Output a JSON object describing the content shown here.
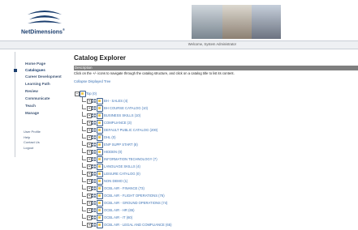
{
  "header": {
    "logo_text": "NetDimensions",
    "logo_superscript": "®",
    "welcome": "Welcome, System Administrator"
  },
  "sidebar": {
    "items": [
      {
        "label": "Home Page",
        "active": false
      },
      {
        "label": "Catalogues",
        "active": true
      },
      {
        "label": "Career Development",
        "active": false
      },
      {
        "label": "Learning Path",
        "active": false
      },
      {
        "label": "Review",
        "active": false
      },
      {
        "label": "Communicate",
        "active": false
      },
      {
        "label": "Teach",
        "active": false
      },
      {
        "label": "Manage",
        "active": false
      }
    ],
    "utility": [
      "User Profile",
      "Help",
      "Contact Us",
      "Logout"
    ]
  },
  "main": {
    "title": "Catalog Explorer",
    "description_label": "Description",
    "instructions": "Click on the +/- icons to navigate through the catalog structure, and click on a catalog title to list its content.",
    "collapse_link": "Collapse Displayed Tree",
    "root": {
      "label": "Top (0)"
    },
    "tree_items": [
      "BH - SALES (4)",
      "BH COURSE CATALOG (10)",
      "BUSINESS SKILLS (10)",
      "COMPLIANCE (3)",
      "DEFAULT PUBLIC CATALOG (200)",
      "DHL (0)",
      "ENP SUPP START (8)",
      "HIDDEN (0)",
      "INFORMATION TECHNOLOGY (7)",
      "LANGUAGE SKILLS (4)",
      "LEISURE CATALOG (0)",
      "NON DEMO (1)",
      "OCBL AIR - FINANCE (73)",
      "OCBL AIR - FLIGHT OPERATIONS (76)",
      "OCBL AIR - GROUND OPERATIONS (74)",
      "OCBL AIR - HR (65)",
      "OCBL AIR - IT (60)",
      "OCBL AIR - LEGAL AND COMPLIANCE (65)"
    ]
  },
  "colors": {
    "brand": "#1b3e6e",
    "link": "#3d73b5",
    "description_bar": "#7f7f7f"
  }
}
